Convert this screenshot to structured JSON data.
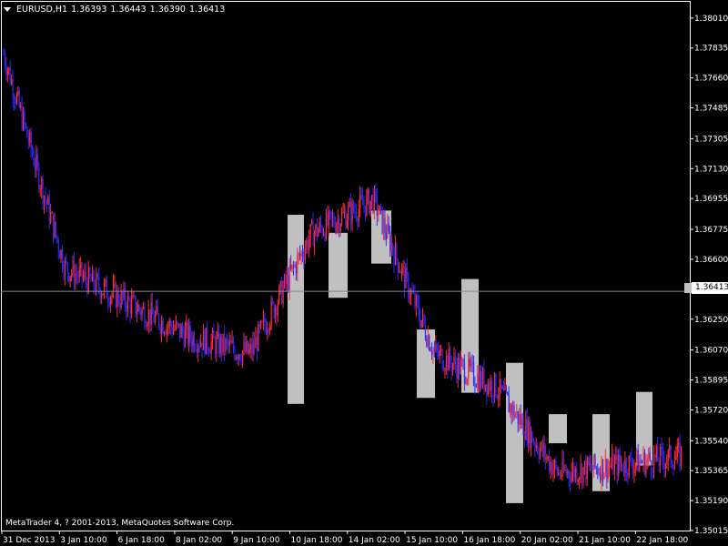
{
  "header": {
    "symbol": "EURUSD,H1",
    "open": "1.36393",
    "high": "1.36443",
    "low": "1.36390",
    "close": "1.36413"
  },
  "copyright": "MetaTrader 4, ? 2001-2013, MetaQuotes Software Corp.",
  "current_price": "1.36413",
  "colors": {
    "background": "#000000",
    "bull_candle": "#ff2a2a",
    "bear_candle": "#2a2aff",
    "highlight_box": "#c0c0c0",
    "bid_line": "#778899",
    "axis": "#ffffff"
  },
  "price_axis_labels": [
    "1.38010",
    "1.37835",
    "1.37660",
    "1.37485",
    "1.37305",
    "1.37130",
    "1.36955",
    "1.36775",
    "1.36600",
    "1.36250",
    "1.36070",
    "1.35895",
    "1.35720",
    "1.35540",
    "1.35365",
    "1.35190",
    "1.35015"
  ],
  "time_axis_labels": [
    "31 Dec 2013",
    "3 Jan 10:00",
    "6 Jan 18:00",
    "8 Jan 02:00",
    "9 Jan 10:00",
    "10 Jan 18:00",
    "14 Jan 02:00",
    "15 Jan 10:00",
    "16 Jan 18:00",
    "20 Jan 02:00",
    "21 Jan 10:00",
    "22 Jan 18:00"
  ],
  "chart_data": {
    "type": "line",
    "title": "EURUSD,H1",
    "xlabel": "",
    "ylabel": "",
    "ylim": [
      1.35015,
      1.3811
    ],
    "x": [
      "31 Dec 2013",
      "3 Jan 10:00",
      "6 Jan 18:00",
      "8 Jan 02:00",
      "9 Jan 10:00",
      "10 Jan 18:00",
      "14 Jan 02:00",
      "15 Jan 10:00",
      "16 Jan 18:00",
      "20 Jan 02:00",
      "21 Jan 10:00",
      "22 Jan 18:00"
    ],
    "series": [
      {
        "name": "",
        "values": [
          1.378,
          1.3655,
          1.3635,
          1.3615,
          1.3605,
          1.3675,
          1.3695,
          1.3605,
          1.3585,
          1.3535,
          1.354,
          1.3545
        ]
      }
    ],
    "highlight_ranges": [
      {
        "from_price": 1.35755,
        "to_price": 1.3686
      },
      {
        "from_price": 1.36375,
        "to_price": 1.36755
      },
      {
        "from_price": 1.36575,
        "to_price": 1.36885
      },
      {
        "from_price": 1.3579,
        "to_price": 1.3619
      },
      {
        "from_price": 1.3582,
        "to_price": 1.36485
      },
      {
        "from_price": 1.35175,
        "to_price": 1.35995
      },
      {
        "from_price": 1.35525,
        "to_price": 1.35695
      },
      {
        "from_price": 1.35245,
        "to_price": 1.35695
      },
      {
        "from_price": 1.35395,
        "to_price": 1.35825
      }
    ],
    "bid_line": 1.36413,
    "grid": false
  }
}
